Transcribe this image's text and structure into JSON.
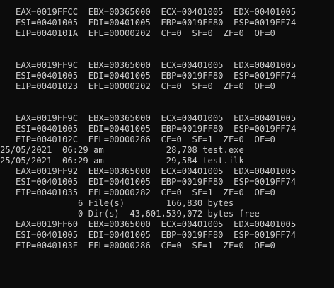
{
  "console": {
    "lines": [
      "   EAX=0019FFCC  EBX=00365000  ECX=00401005  EDX=00401005",
      "   ESI=00401005  EDI=00401005  EBP=0019FF80  ESP=0019FF74",
      "   EIP=0040101A  EFL=00000202  CF=0  SF=0  ZF=0  OF=0",
      "",
      "",
      "   EAX=0019FF9C  EBX=00365000  ECX=00401005  EDX=00401005",
      "   ESI=00401005  EDI=00401005  EBP=0019FF80  ESP=0019FF74",
      "   EIP=00401023  EFL=00000202  CF=0  SF=0  ZF=0  OF=0",
      "",
      "",
      "   EAX=0019FF9C  EBX=00365000  ECX=00401005  EDX=00401005",
      "   ESI=00401005  EDI=00401005  EBP=0019FF80  ESP=0019FF74",
      "   EIP=0040102C  EFL=00000286  CF=0  SF=1  ZF=0  OF=0",
      "25/05/2021  06:29 am            28,708 test.exe",
      "25/05/2021  06:29 am            29,584 test.ilk",
      "   EAX=0019FF92  EBX=00365000  ECX=00401005  EDX=00401005",
      "   ESI=00401005  EDI=00401005  EBP=0019FF80  ESP=0019FF74",
      "   EIP=00401035  EFL=00000282  CF=0  SF=1  ZF=0  OF=0",
      "               6 File(s)        166,830 bytes",
      "               0 Dir(s)  43,601,539,072 bytes free",
      "   EAX=0019FF60  EBX=00365000  ECX=00401005  EDX=00401005",
      "   ESI=00401005  EDI=00401005  EBP=0019FF80  ESP=0019FF74",
      "   EIP=0040103E  EFL=00000286  CF=0  SF=1  ZF=0  OF=0"
    ]
  }
}
